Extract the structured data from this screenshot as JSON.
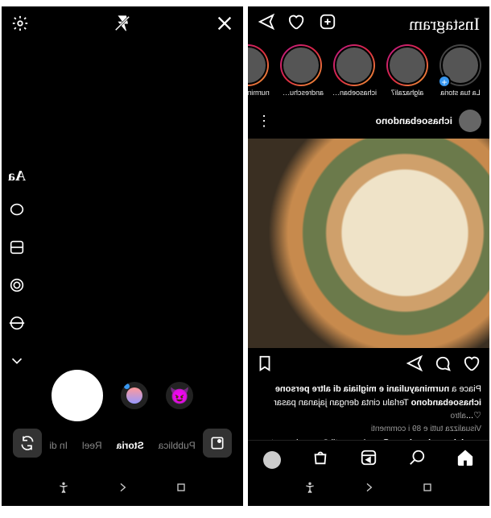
{
  "camera": {
    "modes": [
      "Pubblica",
      "Storia",
      "Reel",
      "In di"
    ],
    "active_mode": "Storia",
    "tool_text": "Aa"
  },
  "feed": {
    "logo": "Instagram",
    "stories": [
      {
        "name": "La tua storia",
        "ring": false,
        "add": true
      },
      {
        "name": "alghazali7",
        "ring": true
      },
      {
        "name": "ichasoeband...",
        "ring": true
      },
      {
        "name": "andreschuer...",
        "ring": true
      },
      {
        "name": "nurminayuli...",
        "ring": true
      }
    ],
    "post": {
      "username": "ichasoebandono",
      "likes_line_prefix": "Piace a ",
      "likes_user": "nurminayuliani",
      "likes_line_suffix": " e migliaia di altre persone",
      "caption_user": "ichasoebandono",
      "caption_text": " Terlalu cinta dengan jajanan pasar ♡...",
      "more": "altro",
      "view_comments": "Visualizza tutti e 89 i commenti",
      "comment_user": "ichasoebandono",
      "comment_text": " @s.sukmawatii Samaa banget. Ga"
    }
  }
}
